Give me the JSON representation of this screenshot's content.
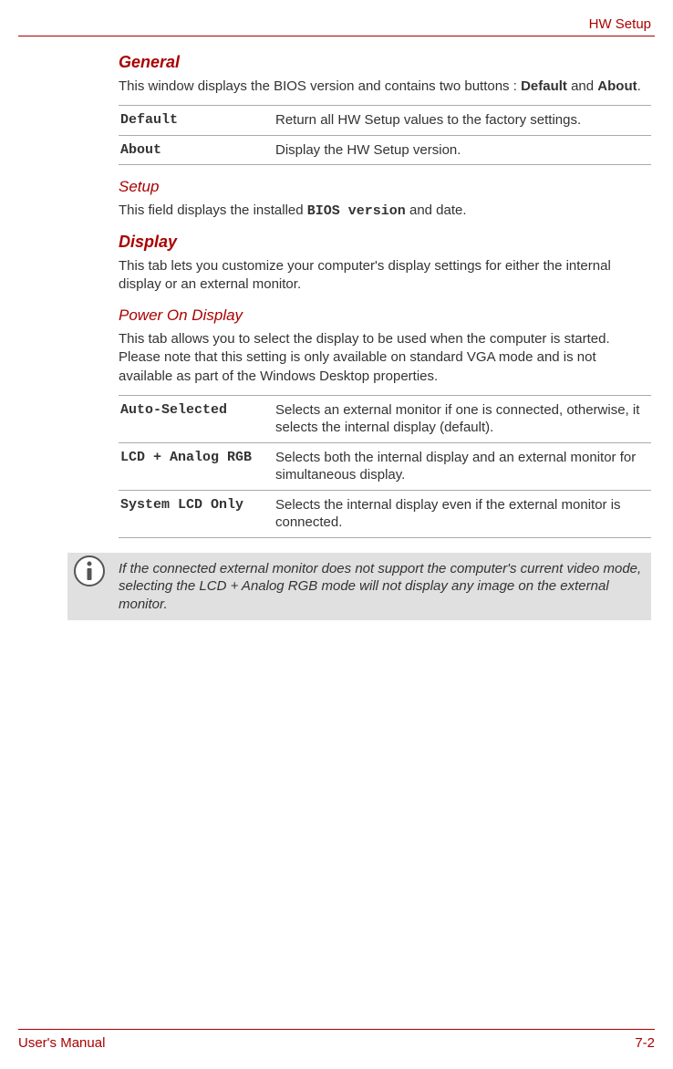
{
  "header": {
    "title": "HW Setup"
  },
  "sections": {
    "general": {
      "heading": "General",
      "intro_pre": "This window displays the BIOS version and contains two buttons : ",
      "intro_b1": "Default",
      "intro_mid": " and ",
      "intro_b2": "About",
      "intro_post": ".",
      "rows": [
        {
          "term": "Default",
          "desc": "Return all HW Setup values to the factory settings."
        },
        {
          "term": "About",
          "desc": "Display the HW Setup version."
        }
      ]
    },
    "setup": {
      "heading": "Setup",
      "text_pre": "This field displays the installed ",
      "text_mono": "BIOS version",
      "text_post": " and date."
    },
    "display": {
      "heading": "Display",
      "text": "This tab lets you customize your computer's display settings for either the internal display or an external monitor."
    },
    "power_on_display": {
      "heading": "Power On Display",
      "text": "This tab allows you to select the display to be used when the computer is started. Please note that this setting is only available on standard VGA mode and is not available as part of the Windows Desktop properties.",
      "rows": [
        {
          "term": "Auto-Selected",
          "desc": "Selects an external monitor if one is connected, otherwise, it selects the internal display (default)."
        },
        {
          "term": "LCD + Analog RGB",
          "desc": "Selects both the internal display and an external monitor for simultaneous display."
        },
        {
          "term": "System LCD Only",
          "desc": "Selects the internal display even if the external monitor is connected."
        }
      ]
    },
    "note": {
      "text": "If the connected external monitor does not support the computer's current video mode, selecting the LCD + Analog RGB mode will not display any image on the external monitor."
    }
  },
  "footer": {
    "left": "User's Manual",
    "right": "7-2"
  }
}
